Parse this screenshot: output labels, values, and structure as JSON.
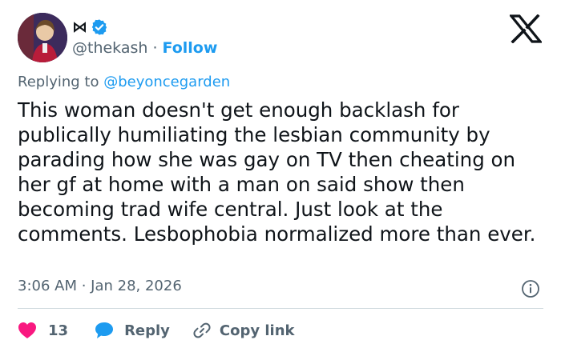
{
  "tweet": {
    "name_glyph": "⋈",
    "handle": "@thekash",
    "separator": "·",
    "follow_label": "Follow",
    "reply_prefix": "Replying to ",
    "reply_to": "@beyoncegarden",
    "text": "This woman doesn't get enough backlash for publically humiliating the lesbian community by parading how she was gay on TV then cheating on her gf at home with a man on said show then becoming trad wife central. Just look at the comments. Lesbophobia normalized more than ever.",
    "timestamp": "3:06 AM · Jan 28, 2026",
    "likes": "13",
    "reply_label": "Reply",
    "copy_link_label": "Copy link"
  },
  "colors": {
    "accent": "#1d9bf0",
    "like": "#f91880",
    "muted_text": "#536471",
    "text": "#0f1419",
    "divider": "#cfd9de"
  },
  "icons": {
    "avatar": "cartoon-avatar",
    "verified": "verified-badge-icon",
    "brand": "x-logo",
    "info": "info-icon",
    "like": "heart-icon",
    "reply": "speech-bubble-icon",
    "copy": "link-icon"
  }
}
